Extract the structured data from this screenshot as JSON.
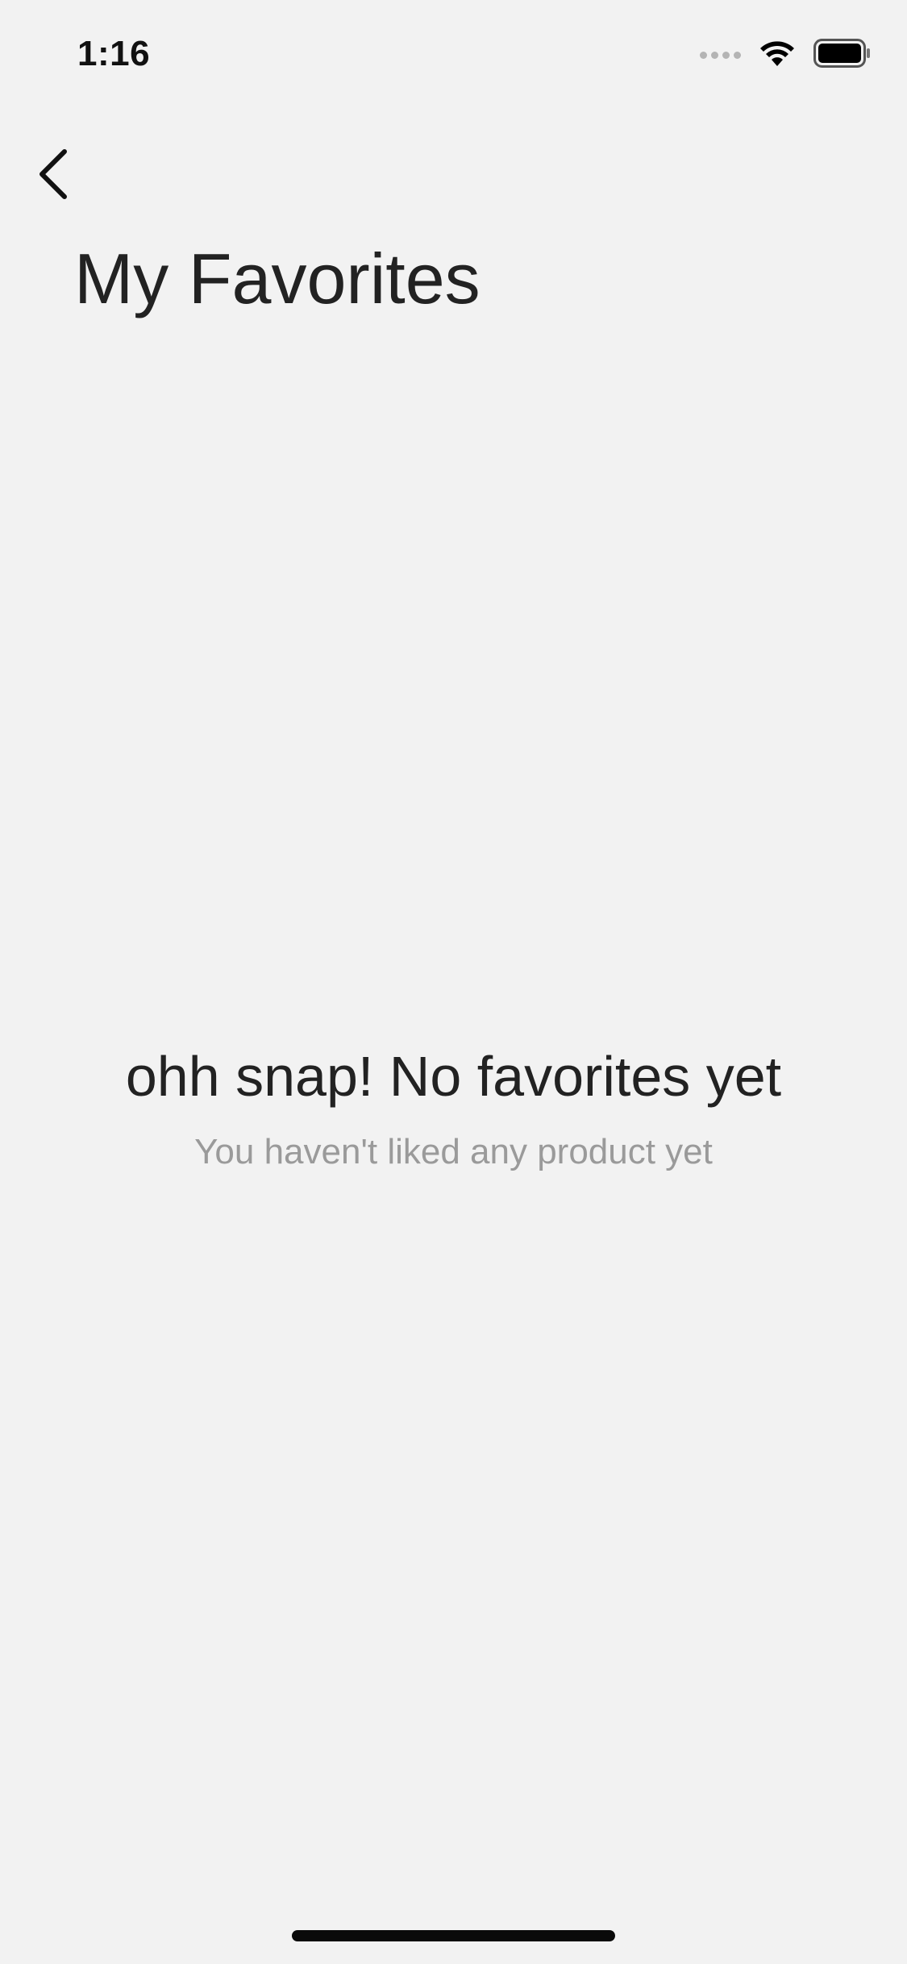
{
  "status_bar": {
    "time": "1:16"
  },
  "header": {
    "back_icon": "chevron-left-icon",
    "title": "My Favorites"
  },
  "empty_state": {
    "title": "ohh snap!  No favorites yet",
    "subtitle": "You haven't liked any product yet"
  },
  "colors": {
    "background": "#f2f2f2",
    "text_primary": "#222222",
    "text_secondary": "#9a9a9a"
  }
}
